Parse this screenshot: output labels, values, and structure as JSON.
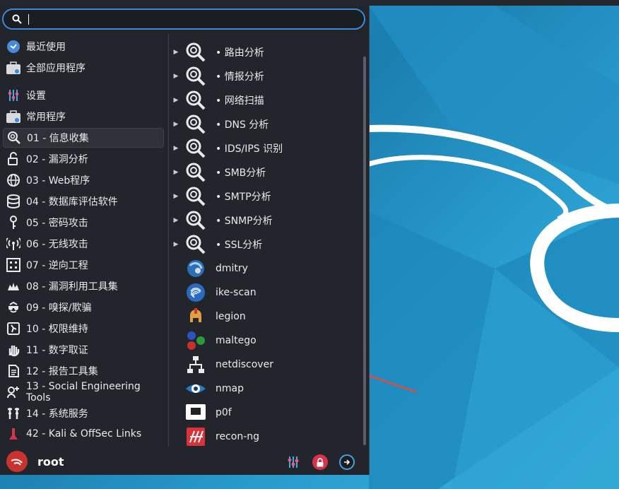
{
  "search": {
    "value": "",
    "placeholder": ""
  },
  "categories": [
    {
      "label": "最近使用",
      "icon": "recent-icon"
    },
    {
      "label": "全部应用程序",
      "icon": "all-apps-icon"
    },
    {
      "label": "设置",
      "icon": "settings-icon"
    },
    {
      "label": "常用程序",
      "icon": "favorites-icon"
    },
    {
      "label": "01 - 信息收集",
      "icon": "info-gathering-icon",
      "active": true
    },
    {
      "label": "02 - 漏洞分析",
      "icon": "vuln-analysis-icon"
    },
    {
      "label": "03 - Web程序",
      "icon": "web-apps-icon"
    },
    {
      "label": "04 - 数据库评估软件",
      "icon": "database-icon"
    },
    {
      "label": "05 - 密码攻击",
      "icon": "password-icon"
    },
    {
      "label": "06 - 无线攻击",
      "icon": "wireless-icon"
    },
    {
      "label": "07 - 逆向工程",
      "icon": "reverse-icon"
    },
    {
      "label": "08 - 漏洞利用工具集",
      "icon": "exploit-icon"
    },
    {
      "label": "09 - 嗅探/欺骗",
      "icon": "sniffing-icon"
    },
    {
      "label": "10 - 权限维持",
      "icon": "post-exploit-icon"
    },
    {
      "label": "11 - 数字取证",
      "icon": "forensics-icon"
    },
    {
      "label": "12 - 报告工具集",
      "icon": "reporting-icon"
    },
    {
      "label": "13 - Social Engineering Tools",
      "icon": "social-eng-icon"
    },
    {
      "label": "14 - 系统服务",
      "icon": "services-icon"
    },
    {
      "label": "42 - Kali & OffSec Links",
      "icon": "kali-links-icon"
    }
  ],
  "apps": [
    {
      "label": "• 路由分析",
      "submenu": true,
      "icon": "magnifier-icon"
    },
    {
      "label": "• 情报分析",
      "submenu": true,
      "icon": "magnifier-icon"
    },
    {
      "label": "• 网络扫描",
      "submenu": true,
      "icon": "magnifier-icon"
    },
    {
      "label": "• DNS 分析",
      "submenu": true,
      "icon": "magnifier-icon"
    },
    {
      "label": "• IDS/IPS 识别",
      "submenu": true,
      "icon": "magnifier-icon"
    },
    {
      "label": "• SMB分析",
      "submenu": true,
      "icon": "magnifier-icon"
    },
    {
      "label": "• SMTP分析",
      "submenu": true,
      "icon": "magnifier-icon"
    },
    {
      "label": "• SNMP分析",
      "submenu": true,
      "icon": "magnifier-icon"
    },
    {
      "label": "• SSL分析",
      "submenu": true,
      "icon": "magnifier-icon"
    },
    {
      "label": "dmitry",
      "submenu": false,
      "icon": "dmitry-icon"
    },
    {
      "label": "ike-scan",
      "submenu": false,
      "icon": "fingerprint-icon"
    },
    {
      "label": "legion",
      "submenu": false,
      "icon": "legion-helmet-icon"
    },
    {
      "label": "maltego",
      "submenu": false,
      "icon": "maltego-icon"
    },
    {
      "label": "netdiscover",
      "submenu": false,
      "icon": "network-icon"
    },
    {
      "label": "nmap",
      "submenu": false,
      "icon": "eye-icon"
    },
    {
      "label": "p0f",
      "submenu": false,
      "icon": "terminal-icon"
    },
    {
      "label": "recon-ng",
      "submenu": false,
      "icon": "recon-ng-icon"
    }
  ],
  "footer": {
    "username": "root"
  },
  "colors": {
    "accent": "#3a8ad8",
    "panel": "#22252b",
    "annotation": "#e84a3a"
  }
}
